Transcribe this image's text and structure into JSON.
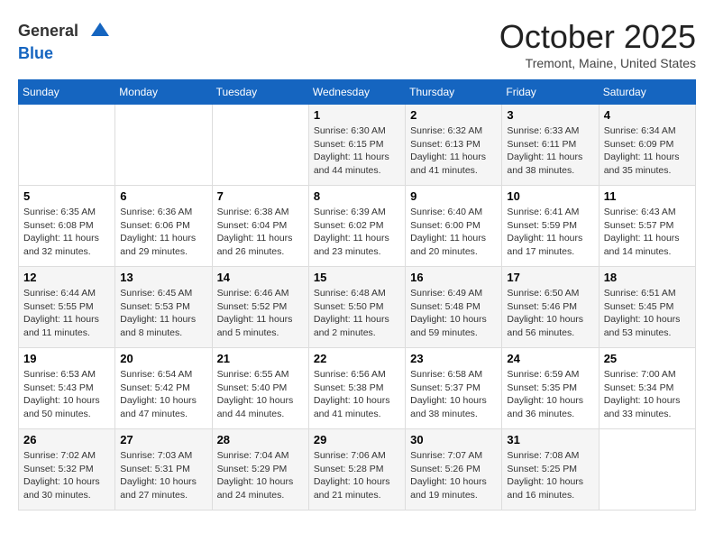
{
  "header": {
    "logo_line1": "General",
    "logo_line2": "Blue",
    "month_title": "October 2025",
    "subtitle": "Tremont, Maine, United States"
  },
  "days_of_week": [
    "Sunday",
    "Monday",
    "Tuesday",
    "Wednesday",
    "Thursday",
    "Friday",
    "Saturday"
  ],
  "weeks": [
    [
      {
        "day": "",
        "info": ""
      },
      {
        "day": "",
        "info": ""
      },
      {
        "day": "",
        "info": ""
      },
      {
        "day": "1",
        "info": "Sunrise: 6:30 AM\nSunset: 6:15 PM\nDaylight: 11 hours\nand 44 minutes."
      },
      {
        "day": "2",
        "info": "Sunrise: 6:32 AM\nSunset: 6:13 PM\nDaylight: 11 hours\nand 41 minutes."
      },
      {
        "day": "3",
        "info": "Sunrise: 6:33 AM\nSunset: 6:11 PM\nDaylight: 11 hours\nand 38 minutes."
      },
      {
        "day": "4",
        "info": "Sunrise: 6:34 AM\nSunset: 6:09 PM\nDaylight: 11 hours\nand 35 minutes."
      }
    ],
    [
      {
        "day": "5",
        "info": "Sunrise: 6:35 AM\nSunset: 6:08 PM\nDaylight: 11 hours\nand 32 minutes."
      },
      {
        "day": "6",
        "info": "Sunrise: 6:36 AM\nSunset: 6:06 PM\nDaylight: 11 hours\nand 29 minutes."
      },
      {
        "day": "7",
        "info": "Sunrise: 6:38 AM\nSunset: 6:04 PM\nDaylight: 11 hours\nand 26 minutes."
      },
      {
        "day": "8",
        "info": "Sunrise: 6:39 AM\nSunset: 6:02 PM\nDaylight: 11 hours\nand 23 minutes."
      },
      {
        "day": "9",
        "info": "Sunrise: 6:40 AM\nSunset: 6:00 PM\nDaylight: 11 hours\nand 20 minutes."
      },
      {
        "day": "10",
        "info": "Sunrise: 6:41 AM\nSunset: 5:59 PM\nDaylight: 11 hours\nand 17 minutes."
      },
      {
        "day": "11",
        "info": "Sunrise: 6:43 AM\nSunset: 5:57 PM\nDaylight: 11 hours\nand 14 minutes."
      }
    ],
    [
      {
        "day": "12",
        "info": "Sunrise: 6:44 AM\nSunset: 5:55 PM\nDaylight: 11 hours\nand 11 minutes."
      },
      {
        "day": "13",
        "info": "Sunrise: 6:45 AM\nSunset: 5:53 PM\nDaylight: 11 hours\nand 8 minutes."
      },
      {
        "day": "14",
        "info": "Sunrise: 6:46 AM\nSunset: 5:52 PM\nDaylight: 11 hours\nand 5 minutes."
      },
      {
        "day": "15",
        "info": "Sunrise: 6:48 AM\nSunset: 5:50 PM\nDaylight: 11 hours\nand 2 minutes."
      },
      {
        "day": "16",
        "info": "Sunrise: 6:49 AM\nSunset: 5:48 PM\nDaylight: 10 hours\nand 59 minutes."
      },
      {
        "day": "17",
        "info": "Sunrise: 6:50 AM\nSunset: 5:46 PM\nDaylight: 10 hours\nand 56 minutes."
      },
      {
        "day": "18",
        "info": "Sunrise: 6:51 AM\nSunset: 5:45 PM\nDaylight: 10 hours\nand 53 minutes."
      }
    ],
    [
      {
        "day": "19",
        "info": "Sunrise: 6:53 AM\nSunset: 5:43 PM\nDaylight: 10 hours\nand 50 minutes."
      },
      {
        "day": "20",
        "info": "Sunrise: 6:54 AM\nSunset: 5:42 PM\nDaylight: 10 hours\nand 47 minutes."
      },
      {
        "day": "21",
        "info": "Sunrise: 6:55 AM\nSunset: 5:40 PM\nDaylight: 10 hours\nand 44 minutes."
      },
      {
        "day": "22",
        "info": "Sunrise: 6:56 AM\nSunset: 5:38 PM\nDaylight: 10 hours\nand 41 minutes."
      },
      {
        "day": "23",
        "info": "Sunrise: 6:58 AM\nSunset: 5:37 PM\nDaylight: 10 hours\nand 38 minutes."
      },
      {
        "day": "24",
        "info": "Sunrise: 6:59 AM\nSunset: 5:35 PM\nDaylight: 10 hours\nand 36 minutes."
      },
      {
        "day": "25",
        "info": "Sunrise: 7:00 AM\nSunset: 5:34 PM\nDaylight: 10 hours\nand 33 minutes."
      }
    ],
    [
      {
        "day": "26",
        "info": "Sunrise: 7:02 AM\nSunset: 5:32 PM\nDaylight: 10 hours\nand 30 minutes."
      },
      {
        "day": "27",
        "info": "Sunrise: 7:03 AM\nSunset: 5:31 PM\nDaylight: 10 hours\nand 27 minutes."
      },
      {
        "day": "28",
        "info": "Sunrise: 7:04 AM\nSunset: 5:29 PM\nDaylight: 10 hours\nand 24 minutes."
      },
      {
        "day": "29",
        "info": "Sunrise: 7:06 AM\nSunset: 5:28 PM\nDaylight: 10 hours\nand 21 minutes."
      },
      {
        "day": "30",
        "info": "Sunrise: 7:07 AM\nSunset: 5:26 PM\nDaylight: 10 hours\nand 19 minutes."
      },
      {
        "day": "31",
        "info": "Sunrise: 7:08 AM\nSunset: 5:25 PM\nDaylight: 10 hours\nand 16 minutes."
      },
      {
        "day": "",
        "info": ""
      }
    ]
  ]
}
